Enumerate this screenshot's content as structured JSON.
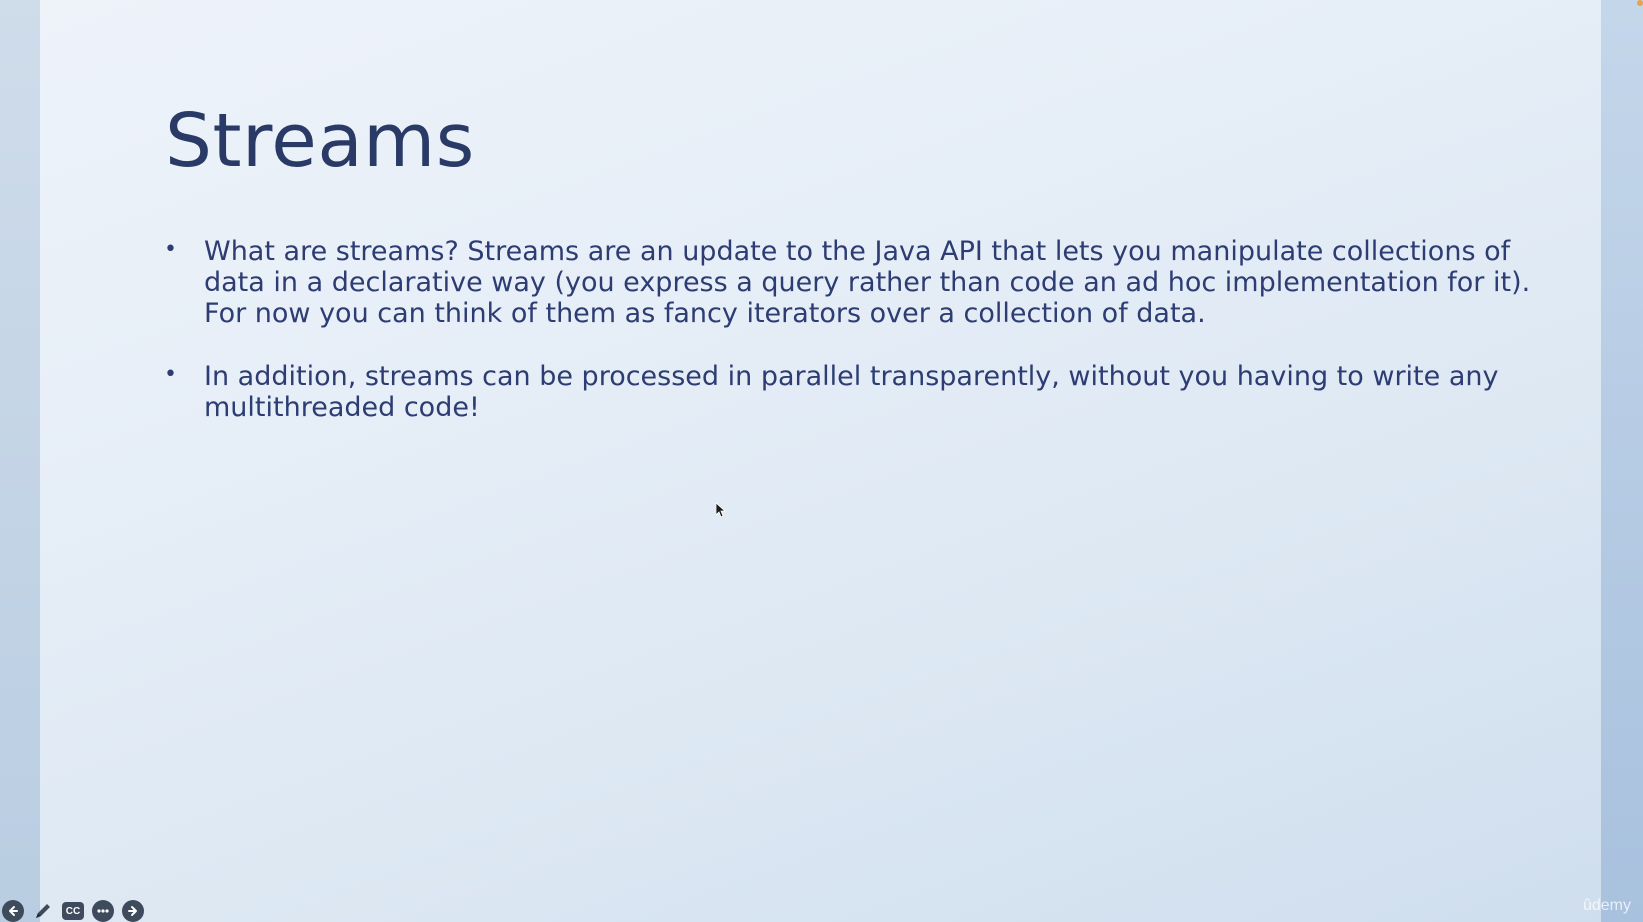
{
  "slide": {
    "title": "Streams",
    "bullets": [
      "What are streams? Streams are an update to the Java API that lets you manipulate collections of data in a declarative way (you express a query rather than code an ad hoc implementation for it). For now you can think of them as fancy iterators over a collection of data.",
      "In addition, streams can be processed in parallel transparently, without you having to write any multithreaded code!"
    ],
    "bullet_glyph": "•"
  },
  "controls": {
    "prev_icon": "arrow-left-icon",
    "pen_icon": "pen-icon",
    "cc_label": "CC",
    "more_icon": "more-icon",
    "next_icon": "arrow-right-icon"
  },
  "watermark": {
    "text": "ûdemy"
  },
  "colors": {
    "title": "#293a66",
    "body_text": "#2d3c72",
    "control_bg": "#3e4b5c"
  }
}
